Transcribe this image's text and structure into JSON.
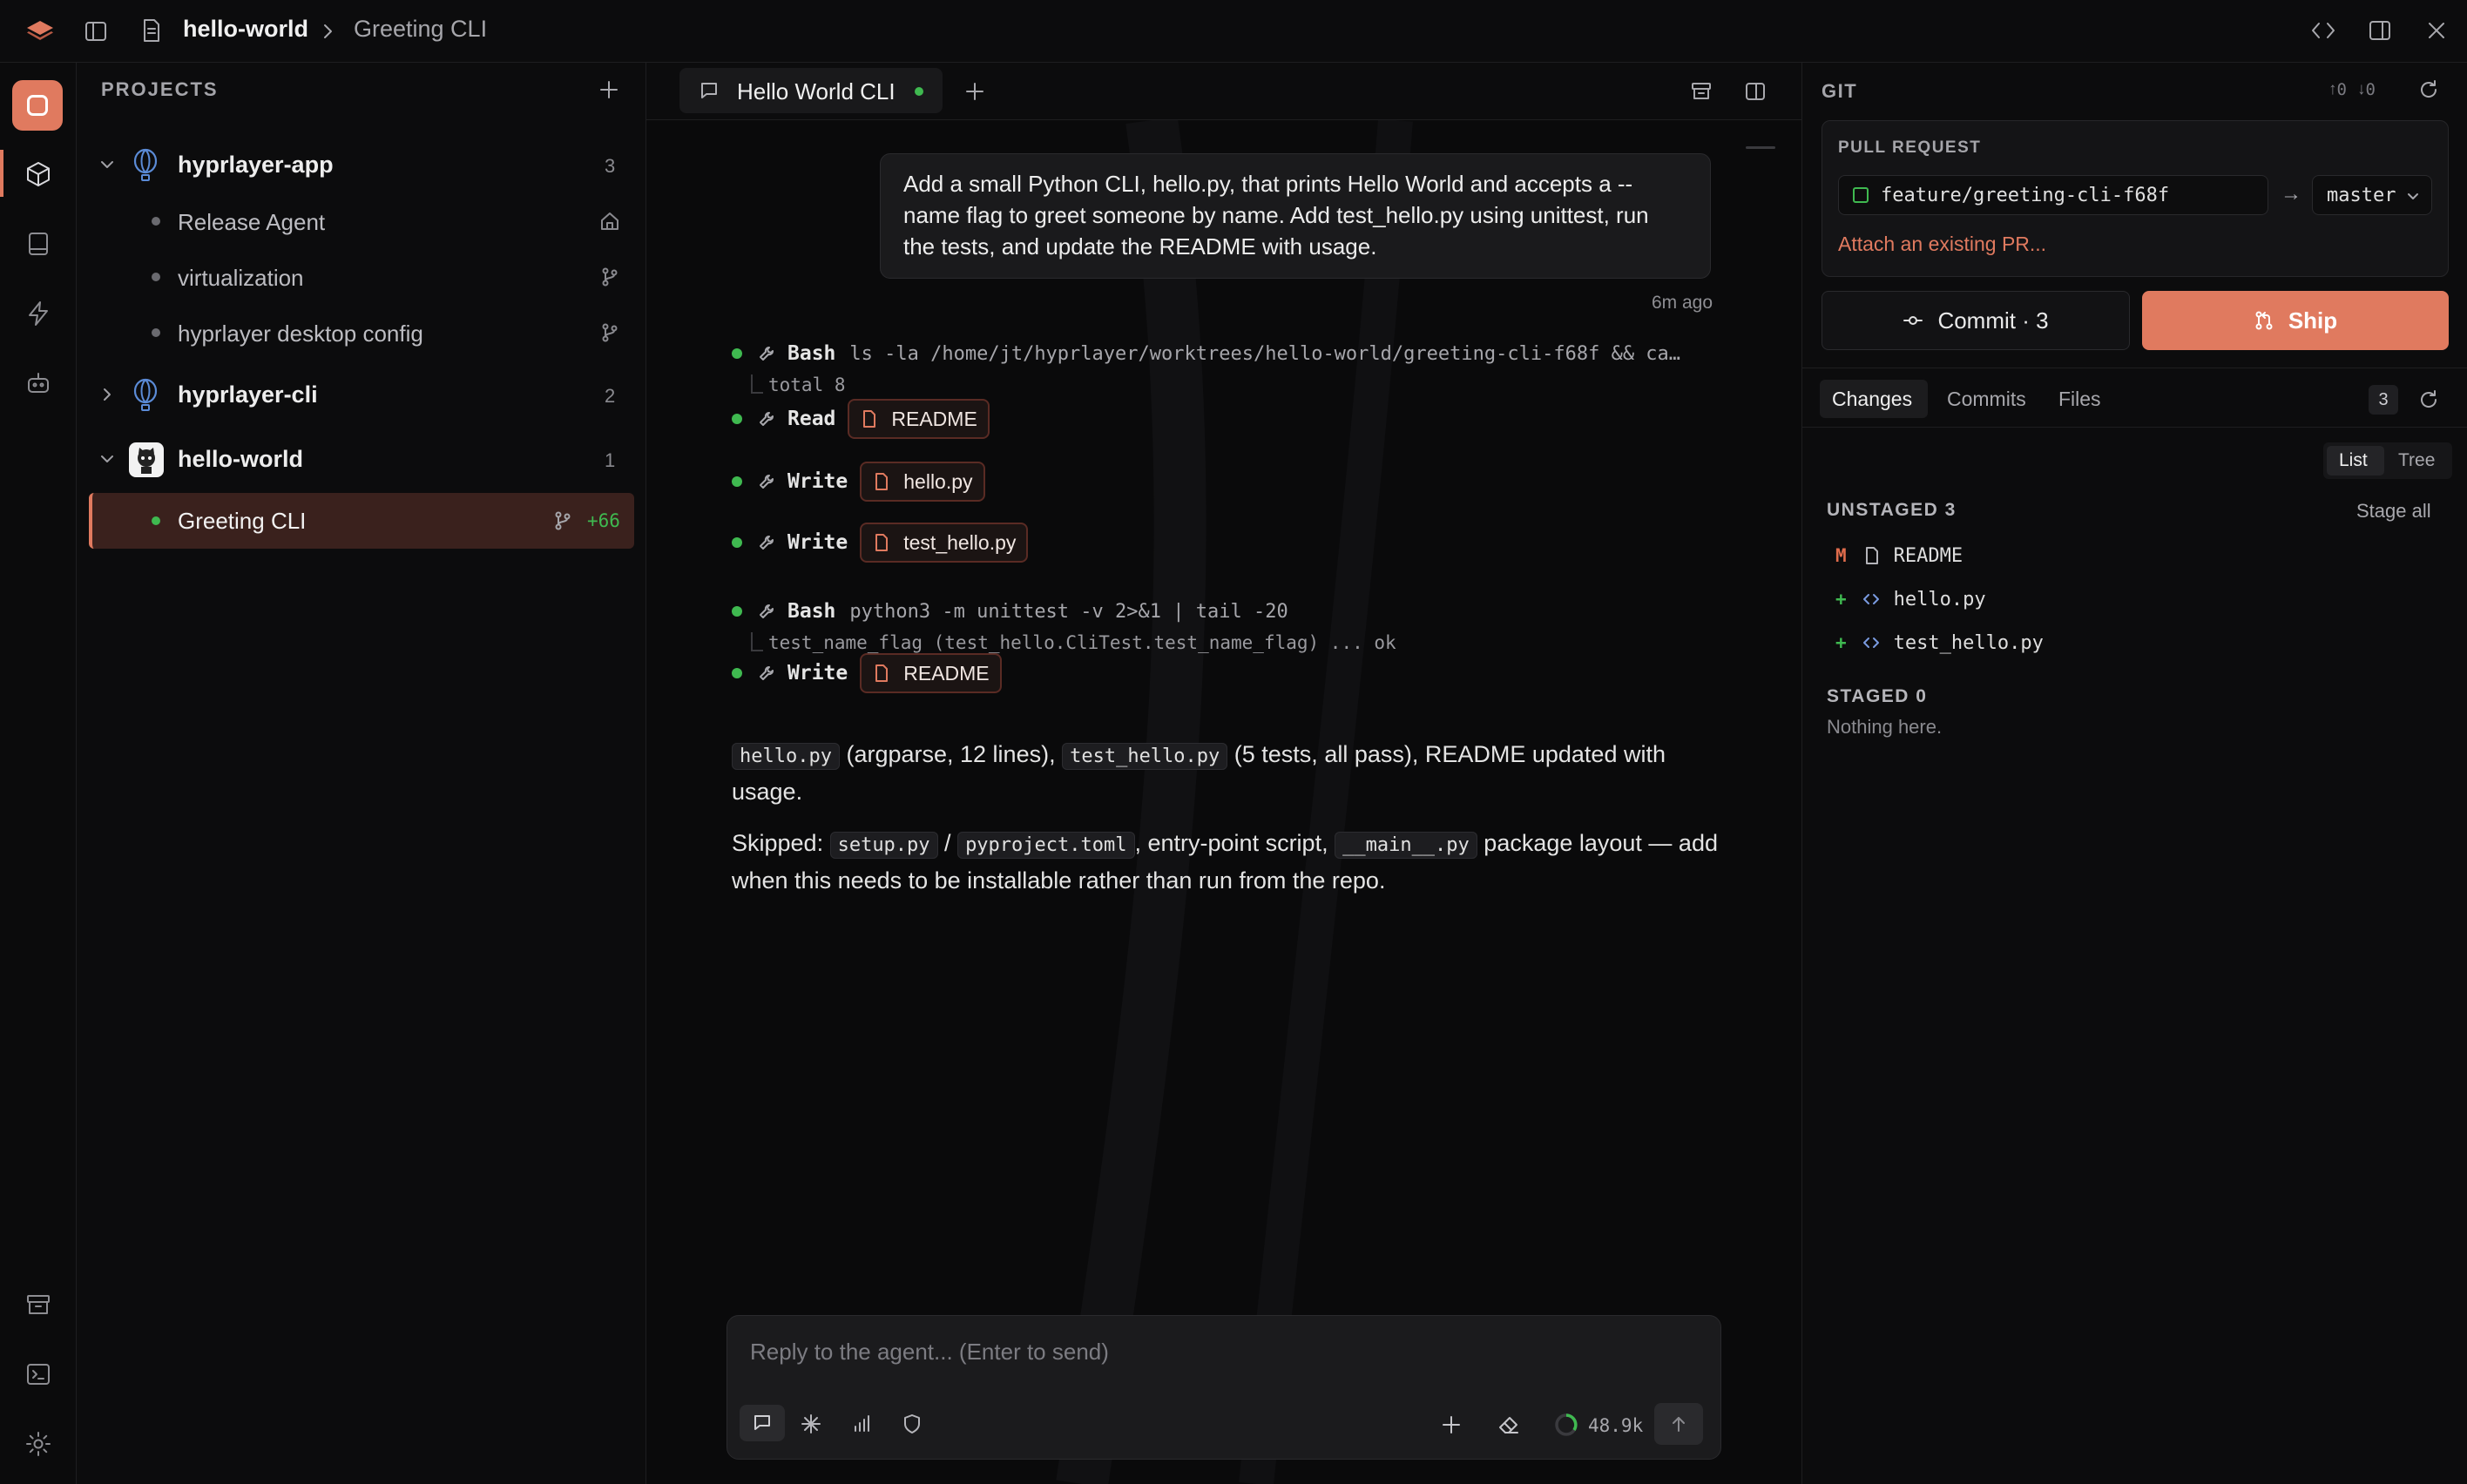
{
  "titlebar": {
    "project": "hello-world",
    "separator": ">",
    "session": "Greeting CLI"
  },
  "sidebar": {
    "header": "PROJECTS",
    "projects": [
      {
        "name": "hyprlayer-app",
        "count": "3",
        "expanded": true,
        "children": [
          {
            "name": "Release Agent",
            "icon": "home-icon"
          },
          {
            "name": "virtualization",
            "icon": "git-branch-icon"
          },
          {
            "name": "hyprlayer desktop config",
            "icon": "git-branch-icon"
          }
        ]
      },
      {
        "name": "hyprlayer-cli",
        "count": "2",
        "expanded": false,
        "children": []
      },
      {
        "name": "hello-world",
        "count": "1",
        "expanded": true,
        "children": [
          {
            "name": "Greeting CLI",
            "icon": "git-branch-icon",
            "delta": "+66",
            "active": true
          }
        ]
      }
    ]
  },
  "tabs": [
    {
      "label": "Hello World CLI",
      "active": true,
      "status_color": "#3fb950"
    }
  ],
  "chat": {
    "user_message": "Add a small Python CLI, hello.py, that prints Hello World and accepts a --name flag to greet someone by name. Add test_hello.py using unittest, run the tests, and update the README with usage.",
    "user_message_lines": [
      "Add a small Python CLI, hello.py, that prints Hello World and accepts a --",
      "name flag to greet someone by name. Add test_hello.py using unittest, run",
      "the tests, and update the README with usage."
    ],
    "timestamp": "6m ago",
    "tools": [
      {
        "name": "Bash",
        "command": "ls -la /home/jt/hyprlayer/worktrees/hello-world/greeting-cli-f68f && ca…",
        "output": "total 8"
      },
      {
        "name": "Read",
        "file": "README"
      },
      {
        "name": "Write",
        "file": "hello.py"
      },
      {
        "name": "Write",
        "file": "test_hello.py"
      },
      {
        "name": "Bash",
        "command": "python3 -m unittest -v 2>&1 | tail -20",
        "output": "test_name_flag (test_hello.CliTest.test_name_flag) ... ok"
      },
      {
        "name": "Write",
        "file": "README"
      }
    ],
    "summary1": {
      "code1": "hello.py",
      "text1": " (argparse, 12 lines), ",
      "code2": "test_hello.py",
      "text2": " (5 tests, all pass), README updated with",
      "text3": "usage."
    },
    "summary2": {
      "text1": "Skipped: ",
      "code1": "setup.py",
      "sep": " / ",
      "code2": "pyproject.toml",
      "text2": ", entry-point script, ",
      "code3": "__main__.py",
      "text3": " package layout — add",
      "text4": "when this needs to be installable rather than run from the repo."
    },
    "input_placeholder": "Reply to the agent...  (Enter to send)",
    "token_count": "48.9k"
  },
  "git": {
    "header": "GIT",
    "ahead": "0",
    "behind": "0",
    "pr_label": "PULL REQUEST",
    "branch": "feature/greeting-cli-f68f",
    "arrow": "→",
    "base_branch": "master",
    "attach_link": "Attach an existing PR...",
    "commit_label": "Commit · 3",
    "ship_label": "Ship",
    "tabs": [
      "Changes",
      "Commits",
      "Files"
    ],
    "changes_count": "3",
    "view_modes": [
      "List",
      "Tree"
    ],
    "unstaged_label": "UNSTAGED 3",
    "stage_all": "Stage all",
    "unstaged": [
      {
        "status": "M",
        "name": "README",
        "status_color": "#e06c4c",
        "icon": "file-icon"
      },
      {
        "status": "+",
        "name": "hello.py",
        "status_color": "#3fb950",
        "icon": "code-icon"
      },
      {
        "status": "+",
        "name": "test_hello.py",
        "status_color": "#3fb950",
        "icon": "code-icon"
      }
    ],
    "staged_label": "STAGED 0",
    "staged_empty": "Nothing here."
  },
  "colors": {
    "accent": "#e07a5f",
    "active_row": "#3a211d",
    "success": "#3fb950"
  }
}
